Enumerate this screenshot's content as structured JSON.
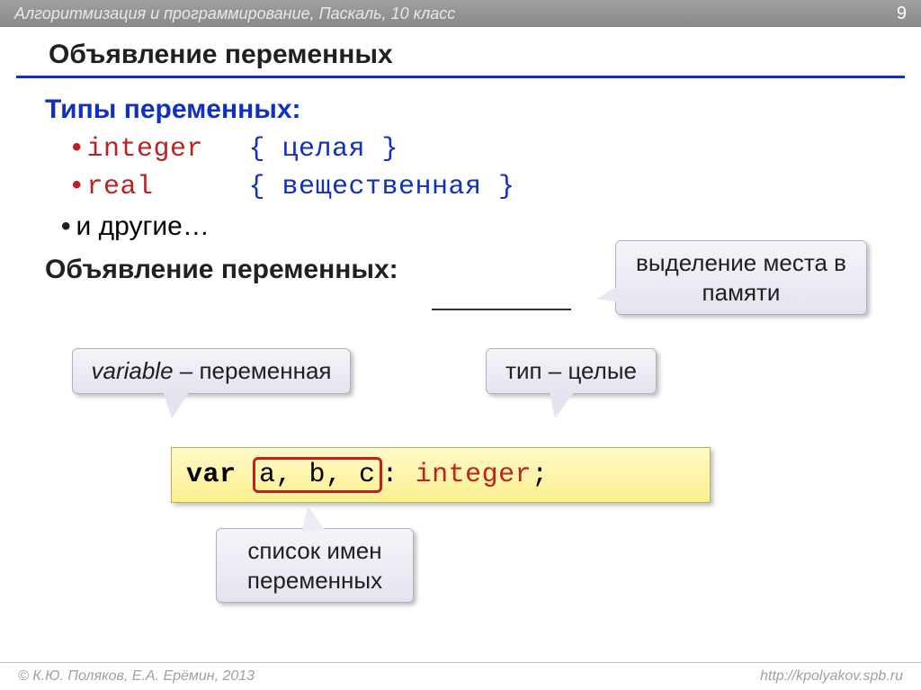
{
  "header": {
    "course": "Алгоритмизация и программирование, Паскаль, 10 класс",
    "page": "9"
  },
  "title": "Объявление переменных",
  "types_heading": "Типы переменных:",
  "types": {
    "integer": {
      "name": "integer",
      "comment": "{ целая }"
    },
    "real": {
      "name": "real",
      "comment": "{ вещественная }"
    },
    "others": "и другие…"
  },
  "decl_heading": "Объявление переменных:",
  "callouts": {
    "memory": "выделение места в памяти",
    "variable_it": "variable",
    "variable_rest": " – переменная",
    "type": "тип – целые",
    "names": "список имен переменных"
  },
  "code": {
    "kw_var": "var ",
    "vars": "a, b, c",
    "colon": ": ",
    "type": "integer",
    "semi": ";"
  },
  "footer": {
    "left": "© К.Ю. Поляков, Е.А. Ерёмин, 2013",
    "right": "http://kpolyakov.spb.ru"
  }
}
